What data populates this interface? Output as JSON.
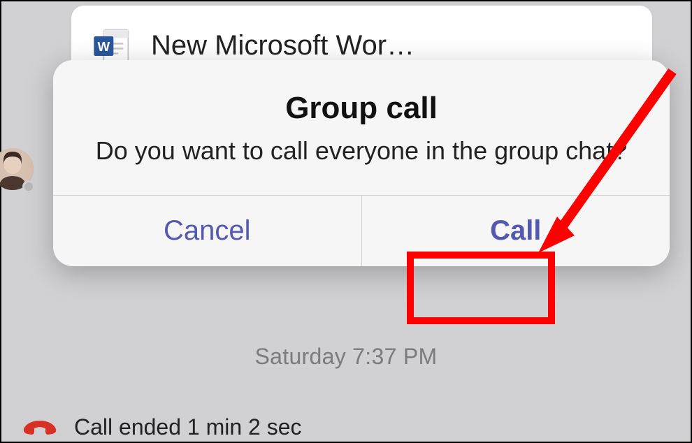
{
  "file_card": {
    "name": "New Microsoft Wor…"
  },
  "timestamp": "Saturday 7:37 PM",
  "call_ended": "Call ended 1 min 2 sec",
  "dialog": {
    "title": "Group call",
    "message": "Do you want to call everyone in the group chat?",
    "cancel_label": "Cancel",
    "confirm_label": "Call"
  }
}
